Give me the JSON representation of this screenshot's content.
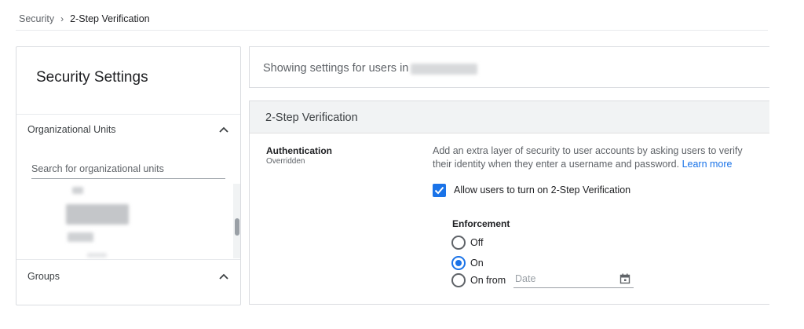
{
  "breadcrumb": {
    "parent": "Security",
    "separator": "›",
    "current": "2-Step Verification"
  },
  "left_panel": {
    "title": "Security Settings",
    "org_units_header": "Organizational Units",
    "search_placeholder": "Search for organizational units",
    "groups_header": "Groups",
    "chevron_icon": "chevron-up-icon"
  },
  "scope": {
    "text": "Showing settings for users in"
  },
  "verification": {
    "title": "2-Step Verification",
    "auth_label": "Authentication",
    "auth_status": "Overridden",
    "description": "Add an extra layer of security to user accounts by asking users to verify their identity when they enter a username and password.",
    "learn_more": "Learn more",
    "allow_label": "Allow users to turn on 2-Step Verification",
    "allow_checked": true,
    "enforcement_title": "Enforcement",
    "options": [
      {
        "label": "Off",
        "selected": false
      },
      {
        "label": "On",
        "selected": true
      },
      {
        "label": "On from",
        "selected": false
      }
    ],
    "date_placeholder": "Date",
    "date_icon": "calendar-icon"
  },
  "colors": {
    "accent": "#1a73e8",
    "text_primary": "#202124",
    "text_secondary": "#5f6368",
    "border": "#dadce0",
    "header_bg": "#f1f3f4"
  }
}
